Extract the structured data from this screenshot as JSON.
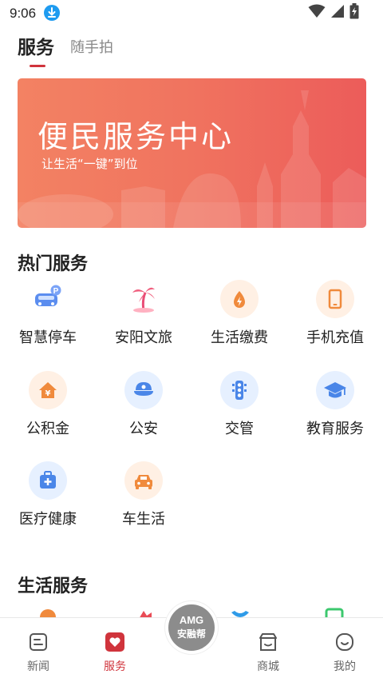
{
  "status_bar": {
    "time": "9:06"
  },
  "tabs": [
    {
      "label": "服务",
      "active": true
    },
    {
      "label": "随手拍",
      "active": false
    }
  ],
  "banner": {
    "title": "便民服务中心",
    "subtitle": "让生活“一键”到位"
  },
  "hot_services": {
    "title": "热门服务",
    "items": [
      {
        "label": "智慧停车",
        "icon": "parking-car-icon"
      },
      {
        "label": "安阳文旅",
        "icon": "palm-tree-icon"
      },
      {
        "label": "生活缴费",
        "icon": "flame-icon"
      },
      {
        "label": "手机充值",
        "icon": "phone-icon"
      },
      {
        "label": "公积金",
        "icon": "house-yen-icon"
      },
      {
        "label": "公安",
        "icon": "police-cap-icon"
      },
      {
        "label": "交管",
        "icon": "traffic-light-icon"
      },
      {
        "label": "教育服务",
        "icon": "graduation-cap-icon"
      },
      {
        "label": "医疗健康",
        "icon": "medical-kit-icon"
      },
      {
        "label": "车生活",
        "icon": "car-icon"
      }
    ]
  },
  "life_services": {
    "title": "生活服务"
  },
  "bottom_nav": {
    "items": [
      {
        "label": "新闻",
        "icon": "news-icon",
        "active": false
      },
      {
        "label": "服务",
        "icon": "service-heart-icon",
        "active": true
      },
      {
        "label": "商城",
        "icon": "store-icon",
        "active": false
      },
      {
        "label": "我的",
        "icon": "profile-icon",
        "active": false
      }
    ],
    "center": {
      "top": "AMG",
      "bottom": "安融帮"
    }
  },
  "colors": {
    "accent": "#d0343c",
    "banner_start": "#f38263",
    "banner_end": "#ec5c5a",
    "blue_icon": "#4a86e8",
    "orange_icon": "#f08a3c"
  }
}
